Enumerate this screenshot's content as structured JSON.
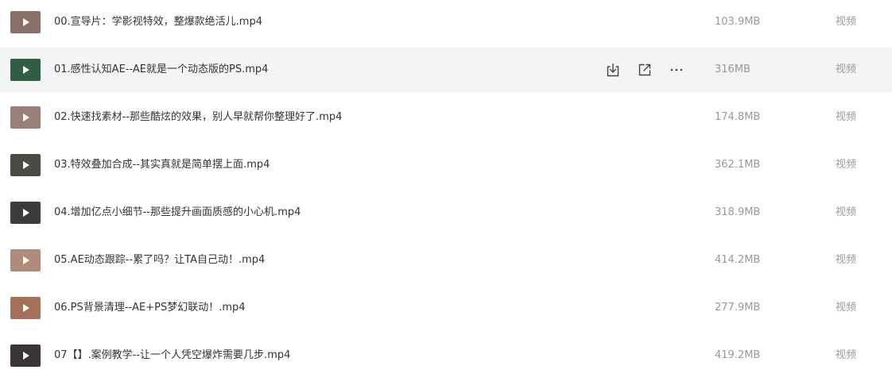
{
  "files": [
    {
      "name": "00.宣导片：学影视特效，整爆款绝活儿.mp4",
      "size": "103.9MB",
      "type": "视频",
      "thumb_color": "#8a6f68"
    },
    {
      "name": "01.感性认知AE--AE就是一个动态版的PS.mp4",
      "size": "316MB",
      "type": "视频",
      "thumb_color": "#2f5e43"
    },
    {
      "name": "02.快速找素材--那些酷炫的效果，别人早就帮你整理好了.mp4",
      "size": "174.8MB",
      "type": "视频",
      "thumb_color": "#9a7e78"
    },
    {
      "name": "03.特效叠加合成--其实真就是简单摆上面.mp4",
      "size": "362.1MB",
      "type": "视频",
      "thumb_color": "#4c4a45"
    },
    {
      "name": "04.增加亿点小细节--那些提升画面质感的小心机.mp4",
      "size": "318.9MB",
      "type": "视频",
      "thumb_color": "#3b3b3d"
    },
    {
      "name": "05.AE动态跟踪--累了吗？让TA自己动！.mp4",
      "size": "414.2MB",
      "type": "视频",
      "thumb_color": "#b08a7c"
    },
    {
      "name": "06.PS背景清理--AE+PS梦幻联动！.mp4",
      "size": "277.9MB",
      "type": "视频",
      "thumb_color": "#a5705a"
    },
    {
      "name": "07【】.案例教学--让一个人凭空爆炸需要几步.mp4",
      "size": "419.2MB",
      "type": "视频",
      "thumb_color": "#3a3638"
    }
  ],
  "hover_actions": {
    "download_icon": "download-icon",
    "share_icon": "share-icon",
    "more_icon": "more-icon"
  },
  "colors": {
    "hover_row_bg": "#f3f4f6",
    "name_text": "#333333",
    "meta_text": "#999999",
    "icon": "#444444"
  }
}
